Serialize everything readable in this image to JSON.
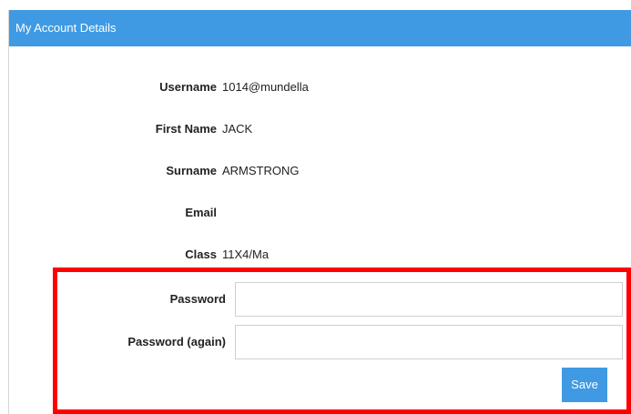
{
  "panel": {
    "title": "My Account Details"
  },
  "details": [
    {
      "label": "Username",
      "value": "1014@mundella"
    },
    {
      "label": "First Name",
      "value": "JACK"
    },
    {
      "label": "Surname",
      "value": "ARMSTRONG"
    },
    {
      "label": "Email",
      "value": ""
    },
    {
      "label": "Class",
      "value": "11X4/Ma"
    }
  ],
  "password": {
    "label": "Password",
    "value": "",
    "placeholder": ""
  },
  "password_again": {
    "label": "Password (again)",
    "value": "",
    "placeholder": ""
  },
  "save_button": {
    "label": "Save"
  },
  "colors": {
    "header_bg": "#3f9ae3",
    "button_bg": "#3f9ae3",
    "highlight_border": "#ff0000"
  }
}
